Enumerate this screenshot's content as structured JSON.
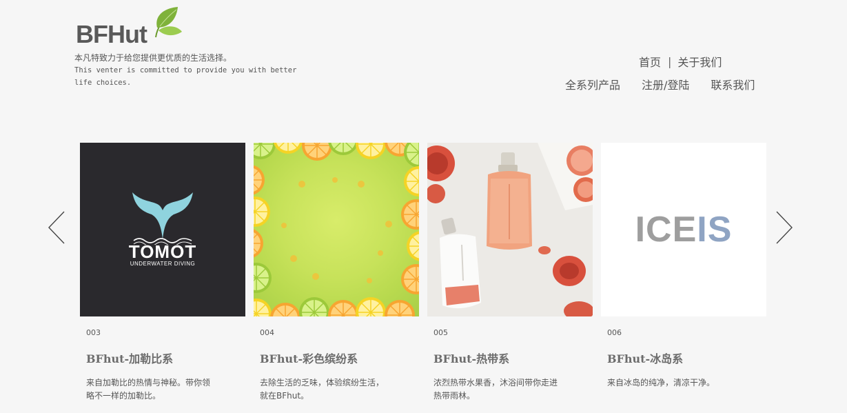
{
  "brand": {
    "logo_text": "BFHut",
    "tagline_cn": "本凡特致力于给您提供更优质的生活选择。",
    "tagline_en": "This venter is committed to provide you with better life choices."
  },
  "nav": {
    "row1": [
      {
        "label": "首页"
      },
      {
        "label": "关于我们"
      }
    ],
    "separator": "|",
    "row2": [
      {
        "label": "全系列产品"
      },
      {
        "label": "注册/登陆"
      },
      {
        "label": "联系我们"
      }
    ]
  },
  "carousel": {
    "prev_icon": "chevron-left-icon",
    "next_icon": "chevron-right-icon",
    "cards": [
      {
        "number": "003",
        "title": "BFhut-加勒比系",
        "desc": "来自加勒比的热情与神秘。带你领略不一样的加勒比。",
        "image": {
          "logo_word": "TOMOT",
          "logo_sub": "UNDERWATER DIVING"
        }
      },
      {
        "number": "004",
        "title": "BFhut-彩色缤纷系",
        "desc": "去除生活的乏味，体验缤纷生活，就在BFhut。",
        "image": {}
      },
      {
        "number": "005",
        "title": "BFhut-热带系",
        "desc": "浓烈热带水果香，沐浴间带你走进热带雨林。",
        "image": {}
      },
      {
        "number": "006",
        "title": "BFhut-冰岛系",
        "desc": "来自冰岛的纯净，清凉干净。",
        "image": {
          "logo_word_a": "ICE",
          "logo_word_b": "IS"
        }
      }
    ]
  },
  "colors": {
    "background": "#f6f6f6",
    "text": "#555555",
    "title": "#6c6c6c",
    "leaf_green": "#7fb23a",
    "tomot_bg": "#2a292d",
    "tomot_whale": "#8fd3de",
    "iceis_gray": "#9e9e9e",
    "iceis_blue": "#8fa4c3"
  }
}
